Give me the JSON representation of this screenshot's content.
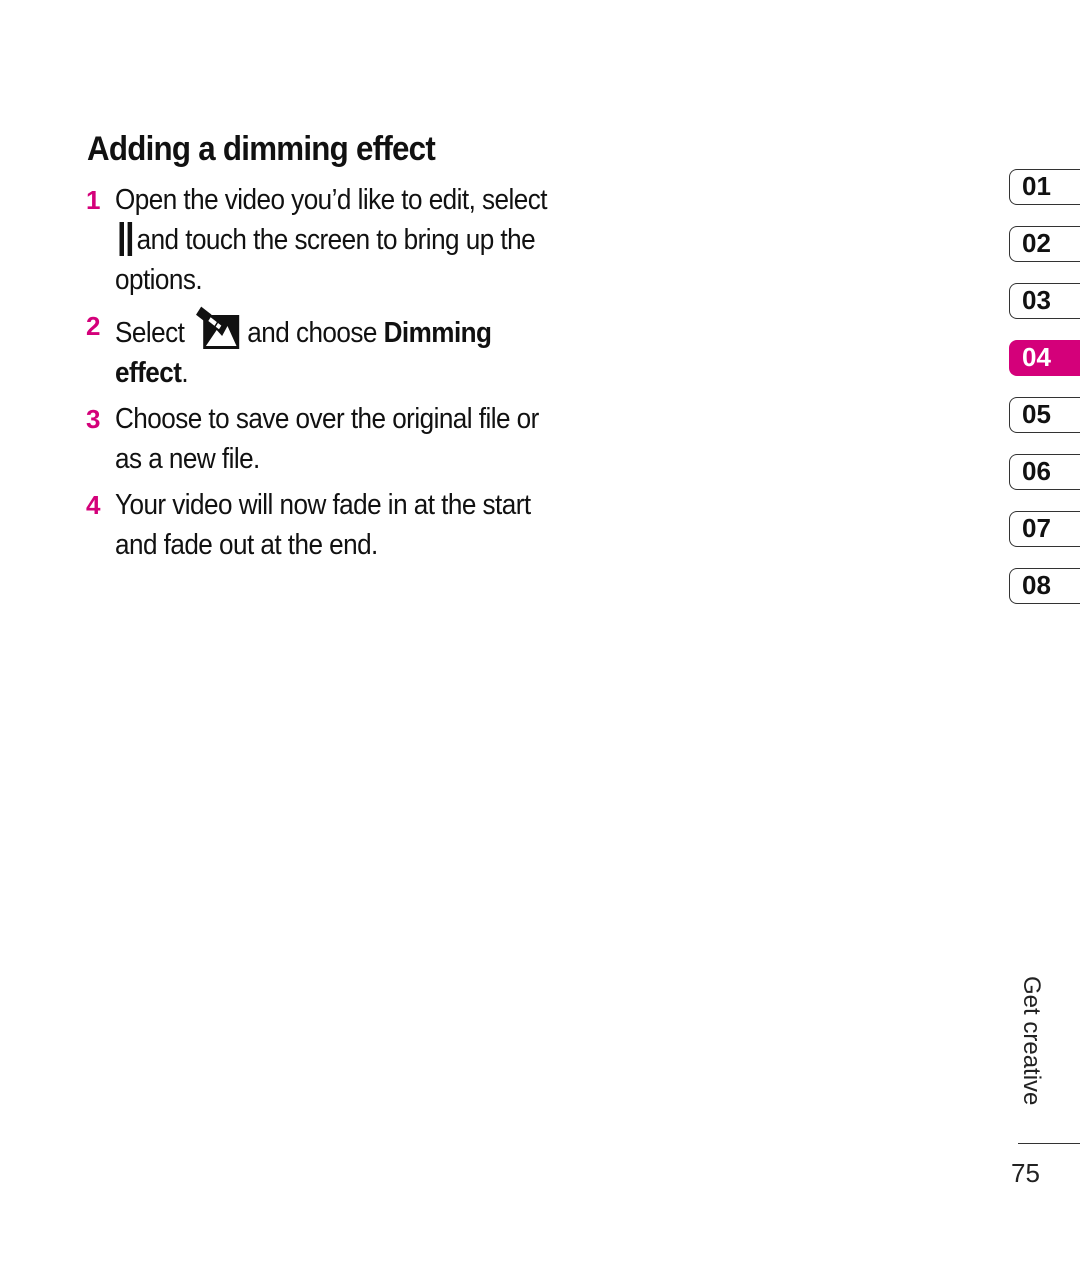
{
  "page": {
    "heading": "Adding a dimming effect",
    "steps": [
      {
        "number": "1",
        "parts": [
          "Open the video you’d like to edit, select",
          "and touch the screen to bring up the options."
        ],
        "icon": "pause-icon"
      },
      {
        "number": "2",
        "parts": [
          "Select",
          "and choose",
          "Dimming effect",
          "."
        ],
        "icon": "dimming-effect-icon"
      },
      {
        "number": "3",
        "text": "Choose to save over the original file or as a new file."
      },
      {
        "number": "4",
        "text": "Your video will now fade in at the start and fade out at the end."
      }
    ]
  },
  "chapter_tabs": {
    "items": [
      "01",
      "02",
      "03",
      "04",
      "05",
      "06",
      "07",
      "08"
    ],
    "active": "04"
  },
  "footer": {
    "section_label": "Get creative",
    "page_number": "75"
  },
  "colors": {
    "accent": "#d4007a",
    "text": "#111111"
  }
}
